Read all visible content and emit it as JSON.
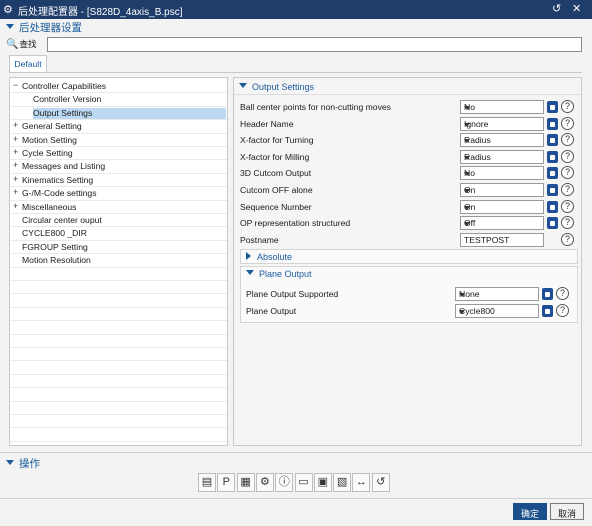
{
  "window": {
    "title": "后处理配置器 - [S828D_4axis_B.psc]"
  },
  "header": {
    "section_title": "后处理器设置",
    "search_label": "查找",
    "search_value": ""
  },
  "tabs": [
    {
      "label": "Default"
    }
  ],
  "tree": {
    "items": [
      {
        "label": "Controller Capabilities",
        "expander": "-",
        "level": 0
      },
      {
        "label": "Controller Version",
        "expander": "",
        "level": 1
      },
      {
        "label": "Output Settings",
        "expander": "",
        "level": 1,
        "selected": true
      },
      {
        "label": "General Setting",
        "expander": "+",
        "level": 0
      },
      {
        "label": "Motion Setting",
        "expander": "+",
        "level": 0
      },
      {
        "label": "Cycle Setting",
        "expander": "+",
        "level": 0
      },
      {
        "label": "Messages and Listing",
        "expander": "+",
        "level": 0
      },
      {
        "label": "Kinematics Setting",
        "expander": "+",
        "level": 0
      },
      {
        "label": "G-/M-Code settings",
        "expander": "+",
        "level": 0
      },
      {
        "label": "Miscellaneous",
        "expander": "+",
        "level": 0
      },
      {
        "label": "Circular center ouput",
        "expander": "",
        "level": 0
      },
      {
        "label": "CYCLE800 _DIR",
        "expander": "",
        "level": 0
      },
      {
        "label": "FGROUP Setting",
        "expander": "",
        "level": 0
      },
      {
        "label": "Motion Resolution",
        "expander": "",
        "level": 0
      }
    ]
  },
  "output_settings": {
    "title": "Output Settings",
    "rows": [
      {
        "label": "Ball center points for non-cutting moves",
        "value": "No",
        "kind": "dropdown"
      },
      {
        "label": "Header Name",
        "value": "Ignore",
        "kind": "dropdown"
      },
      {
        "label": "X-factor for Turning",
        "value": "Radius",
        "kind": "dropdown"
      },
      {
        "label": "X-factor for Milling",
        "value": "Radius",
        "kind": "dropdown"
      },
      {
        "label": "3D Cutcom Output",
        "value": "No",
        "kind": "dropdown"
      },
      {
        "label": "Cutcom OFF alone",
        "value": "On",
        "kind": "dropdown"
      },
      {
        "label": "Sequence Number",
        "value": "On",
        "kind": "dropdown"
      },
      {
        "label": "OP representation structured",
        "value": "Off",
        "kind": "dropdown"
      },
      {
        "label": "Postname",
        "value": "TESTPOST",
        "kind": "text"
      }
    ],
    "absolute": {
      "title": "Absolute"
    },
    "plane_output": {
      "title": "Plane Output",
      "rows": [
        {
          "label": "Plane Output Supported",
          "value": "None"
        },
        {
          "label": "Plane Output",
          "value": "Cycle800"
        }
      ]
    }
  },
  "actions": {
    "title": "操作"
  },
  "toolbar_icons": [
    "toolbar-docs-icon",
    "toolbar-pdf-icon",
    "toolbar-table-icon",
    "toolbar-settings-icon",
    "toolbar-info-icon",
    "toolbar-open-icon",
    "toolbar-save-icon",
    "toolbar-save-as-icon",
    "toolbar-link-icon",
    "toolbar-undo-icon"
  ],
  "buttons": {
    "ok": "确定",
    "cancel": "取消"
  },
  "colors": {
    "titlebar": "#1f3d6a",
    "accent": "#1b5b9b",
    "selection": "#bcd8f2",
    "ok_button": "#1c4e8c"
  }
}
